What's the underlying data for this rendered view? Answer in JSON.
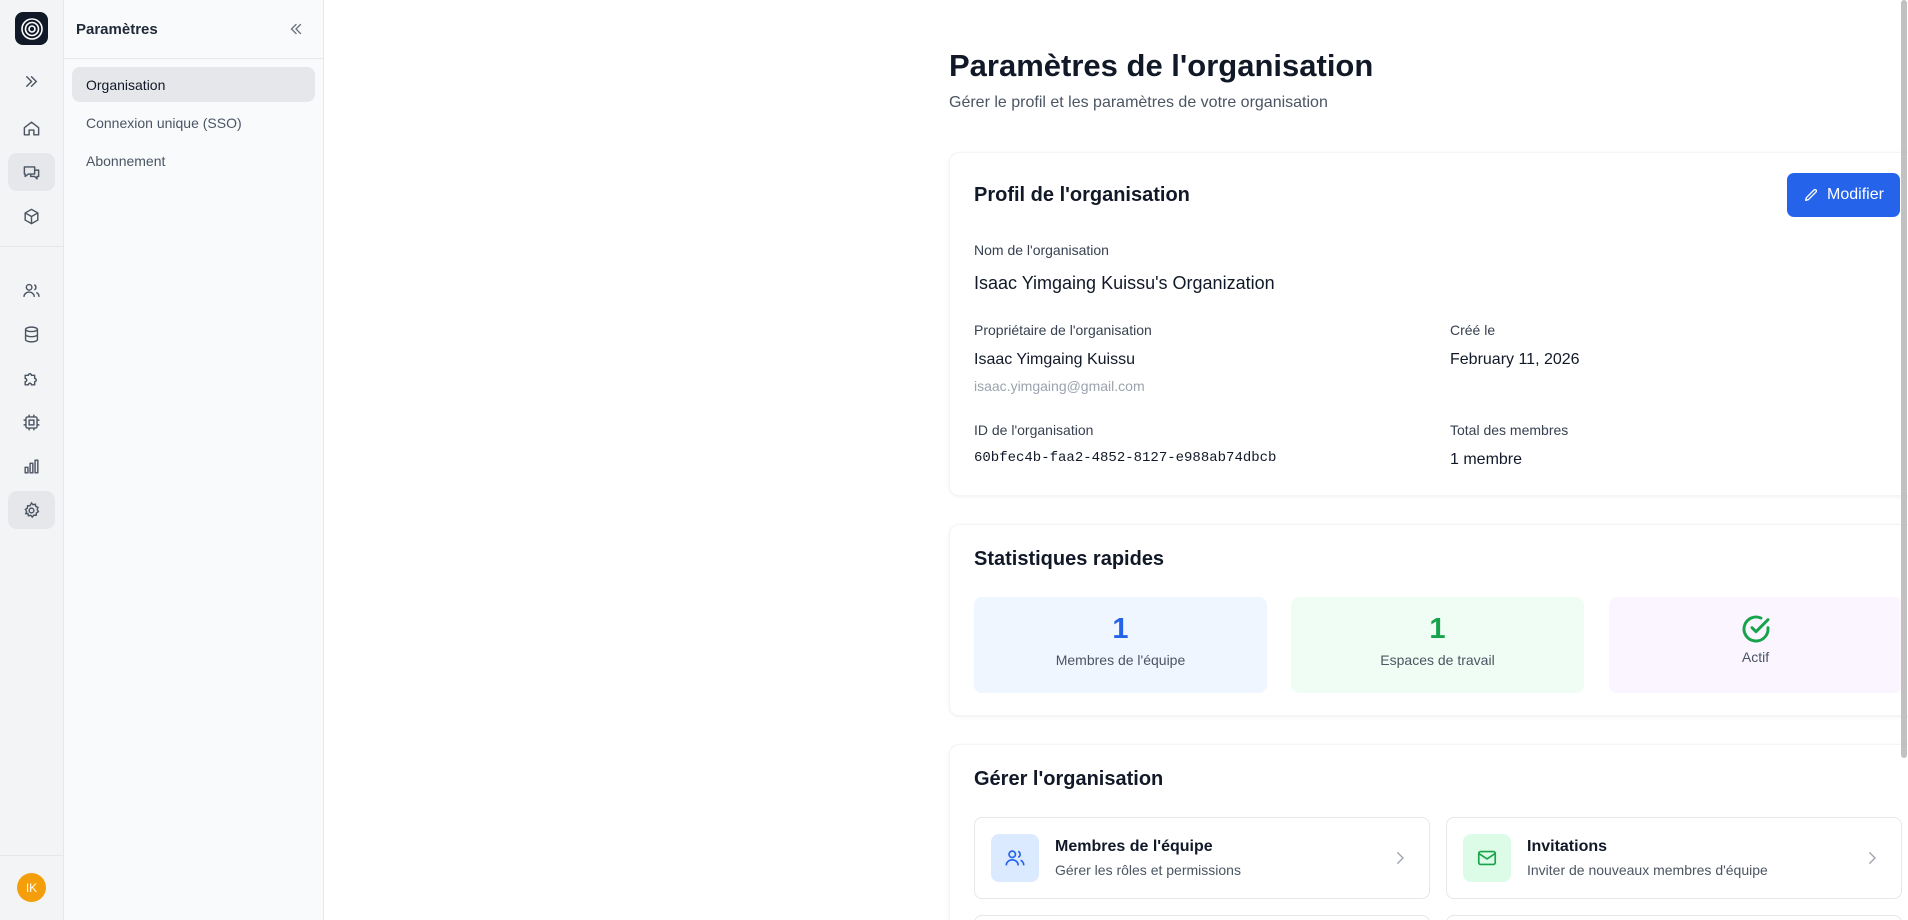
{
  "rail": {
    "avatar_initials": "IK",
    "items": [
      "expand-icon",
      "home-icon",
      "chat-icon",
      "cube-icon",
      "users-icon",
      "database-icon",
      "puzzle-icon",
      "cpu-icon",
      "chart-icon",
      "gear-icon"
    ],
    "active": [
      "chat-icon",
      "gear-icon"
    ]
  },
  "sidebar": {
    "title": "Paramètres",
    "items": [
      {
        "label": "Organisation",
        "active": true
      },
      {
        "label": "Connexion unique (SSO)",
        "active": false
      },
      {
        "label": "Abonnement",
        "active": false
      }
    ]
  },
  "page": {
    "title": "Paramètres de l'organisation",
    "subtitle": "Gérer le profil et les paramètres de votre organisation"
  },
  "profile": {
    "title": "Profil de l'organisation",
    "edit_label": "Modifier",
    "name_label": "Nom de l'organisation",
    "name_value": "Isaac Yimgaing Kuissu's Organization",
    "owner_label": "Propriétaire de l'organisation",
    "owner_name": "Isaac Yimgaing Kuissu",
    "owner_email": "isaac.yimgaing@gmail.com",
    "created_label": "Créé le",
    "created_value": "February 11, 2026",
    "id_label": "ID de l'organisation",
    "id_value": "60bfec4b-faa2-4852-8127-e988ab74dbcb",
    "members_label": "Total des membres",
    "members_value": "1 membre"
  },
  "stats": {
    "title": "Statistiques rapides",
    "items": [
      {
        "value": "1",
        "label": "Membres de l'équipe",
        "color": "#2563eb"
      },
      {
        "value": "1",
        "label": "Espaces de travail",
        "color": "#16a34a"
      },
      {
        "icon": "check-circle-icon",
        "label": "Actif",
        "color": "#16a34a"
      }
    ]
  },
  "manage": {
    "title": "Gérer l'organisation",
    "items": [
      {
        "title": "Membres de l'équipe",
        "desc": "Gérer les rôles et permissions",
        "icon": "users-icon"
      },
      {
        "title": "Invitations",
        "desc": "Inviter de nouveaux membres d'équipe",
        "icon": "mail-icon"
      }
    ]
  },
  "colors": {
    "accent": "#2563eb",
    "success": "#16a34a",
    "avatar": "#f59e0b"
  }
}
